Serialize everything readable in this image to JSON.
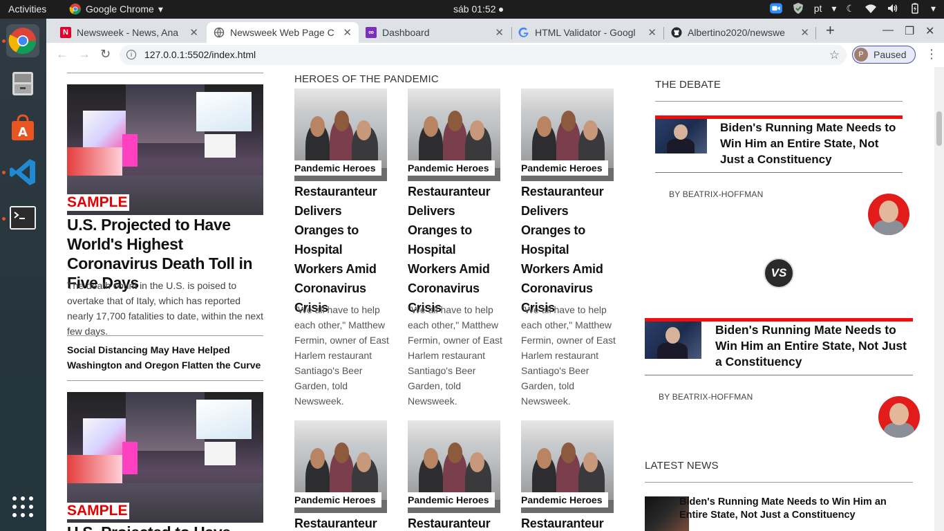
{
  "os": {
    "activities": "Activities",
    "app_name": "Google Chrome",
    "clock": "sáb 01:52",
    "language": "pt"
  },
  "browser": {
    "tabs": [
      {
        "title": "Newsweek - News, Ana",
        "favicon": "newsweek-n-icon",
        "active": false
      },
      {
        "title": "Newsweek Web Page C",
        "favicon": "globe-icon",
        "active": true
      },
      {
        "title": "Dashboard",
        "favicon": "dashboard-icon",
        "active": false
      },
      {
        "title": "HTML Validator - Googl",
        "favicon": "google-g-icon",
        "active": false
      },
      {
        "title": "Albertino2020/newswe",
        "favicon": "github-icon",
        "active": false
      }
    ],
    "new_tab": "+",
    "url": "127.0.0.1:5502/index.html",
    "profile_initial": "P",
    "profile_status": "Paused"
  },
  "page": {
    "left": {
      "feature1": {
        "label": "SAMPLE",
        "headline": "U.S. Projected to Have World's Highest Coronavirus Death Toll in Five Days",
        "body": "The death count in the U.S. is poised to overtake that of Italy, which has reported nearly 17,700 fatalities to date, within the next few days."
      },
      "secondary_headline": "Social Distancing May Have Helped Washington and Oregon Flatten the Curve",
      "feature2": {
        "label": "SAMPLE",
        "headline": "U.S. Projected to Have"
      }
    },
    "middle": {
      "section_title": "HEROES OF THE PANDEMIC",
      "cards": [
        {
          "tag": "Pandemic Heroes",
          "headline": "Restauranteur Delivers Oranges to Hospital Workers Amid Coronavirus Crisis",
          "quote": "\"We all have to help each other,\" Matthew Fermin, owner of East Harlem restaurant Santiago's Beer Garden, told Newsweek."
        },
        {
          "tag": "Pandemic Heroes",
          "headline": "Restauranteur Delivers Oranges to Hospital Workers Amid Coronavirus Crisis",
          "quote": "\"We all have to help each other,\" Matthew Fermin, owner of East Harlem restaurant Santiago's Beer Garden, told Newsweek."
        },
        {
          "tag": "Pandemic Heroes",
          "headline": "Restauranteur Delivers Oranges to Hospital Workers Amid Coronavirus Crisis",
          "quote": "\"We all have to help each other,\" Matthew Fermin, owner of East Harlem restaurant Santiago's Beer Garden, told Newsweek."
        }
      ],
      "cards_row2": [
        {
          "tag": "Pandemic Heroes",
          "headline": "Restauranteur"
        },
        {
          "tag": "Pandemic Heroes",
          "headline": "Restauranteur"
        },
        {
          "tag": "Pandemic Heroes",
          "headline": "Restauranteur"
        }
      ]
    },
    "right": {
      "debate_title": "THE DEBATE",
      "debate1": {
        "headline": "Biden's Running Mate Needs to Win Him an Entire State, Not Just a Constituency",
        "byline": "BY BEATRIX-HOFFMAN"
      },
      "vs": "VS",
      "debate2": {
        "headline": "Biden's Running Mate Needs to Win Him an Entire State, Not Just a Constituency",
        "byline": "BY BEATRIX-HOFFMAN"
      },
      "latest_title": "LATEST NEWS",
      "latest1": {
        "headline": "Biden's Running Mate Needs to Win Him an Entire State, Not Just a Constituency"
      }
    }
  },
  "colors": {
    "accent_red": "#f20d0d",
    "sample_red": "#e60000",
    "topbar": "#1d1d1d",
    "tabstrip": "#dee1e6"
  }
}
